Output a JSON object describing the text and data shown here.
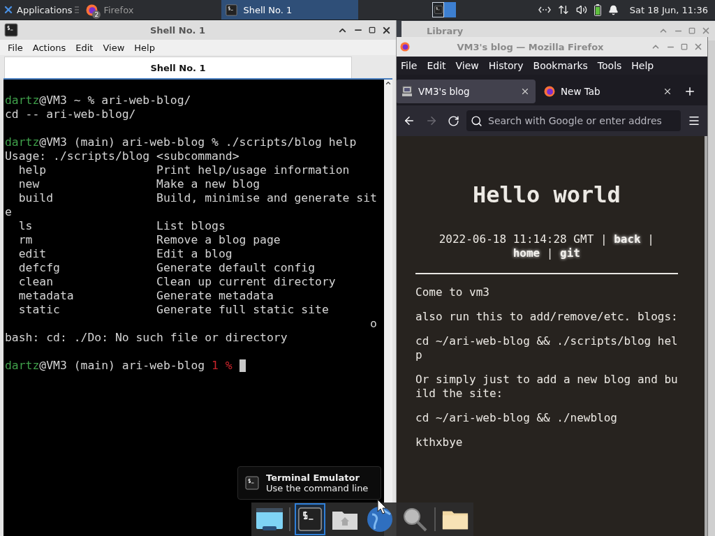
{
  "top_panel": {
    "apps_menu": "Applications",
    "tasks": [
      {
        "label": "Firefox",
        "badge": "2",
        "kind": "browser",
        "selected": false
      },
      {
        "label": "Shell No. 1",
        "kind": "terminal",
        "selected": true
      }
    ],
    "workspaces": [
      {
        "selected": true
      },
      {
        "selected": false
      }
    ],
    "clock": "Sat 18 Jun, 11:36"
  },
  "terminal": {
    "title": "Shell No. 1",
    "menu": [
      "File",
      "Actions",
      "Edit",
      "View",
      "Help"
    ],
    "tabs": [
      {
        "label": "Shell No. 1",
        "selected": true
      }
    ],
    "blocks": [
      {
        "lines": [
          {
            "spans": [
              {
                "text": "dartz",
                "color": "#3f9f4a"
              },
              {
                "text": "@VM3 ~ % ari-web-blog/"
              }
            ]
          },
          {
            "spans": [
              {
                "text": "cd -- ari-web-blog/"
              }
            ]
          }
        ]
      },
      {
        "lines": [
          {
            "spans": [
              {
                "text": "dartz",
                "color": "#3f9f4a"
              },
              {
                "text": "@VM3 (main) ari-web-blog % ./scripts/blog help"
              }
            ]
          },
          {
            "spans": [
              {
                "text": "Usage: ./scripts/blog <subcommand>"
              }
            ]
          },
          {
            "spans": [
              {
                "text": "  help                Print help/usage information"
              }
            ]
          },
          {
            "spans": [
              {
                "text": "  new                 Make a new blog"
              }
            ]
          },
          {
            "spans": [
              {
                "text": "  build               Build, minimise and generate sit"
              }
            ]
          },
          {
            "spans": [
              {
                "text": "e"
              }
            ]
          },
          {
            "spans": [
              {
                "text": "  ls                  List blogs"
              }
            ]
          },
          {
            "spans": [
              {
                "text": "  rm                  Remove a blog page"
              }
            ]
          },
          {
            "spans": [
              {
                "text": "  edit                Edit a blog"
              }
            ]
          },
          {
            "spans": [
              {
                "text": "  defcfg              Generate default config"
              }
            ]
          },
          {
            "spans": [
              {
                "text": "  clean               Clean up current directory"
              }
            ]
          },
          {
            "spans": [
              {
                "text": "  metadata            Generate metadata"
              }
            ]
          },
          {
            "spans": [
              {
                "text": "  static              Generate full static site"
              }
            ]
          },
          {
            "spans": [
              {
                "text": "                                                     o"
              }
            ]
          },
          {
            "spans": [
              {
                "text": "bash: cd: ./Do: No such file or directory"
              }
            ]
          }
        ]
      },
      {
        "lines": [
          {
            "cursor": true,
            "spans": [
              {
                "text": "dartz",
                "color": "#3f9f4a"
              },
              {
                "text": "@VM3 (main) ari-web-blog "
              },
              {
                "text": "1 %",
                "color": "#c8242b"
              }
            ]
          }
        ]
      }
    ]
  },
  "library": {
    "title": "Library"
  },
  "firefox": {
    "title": "VM3's blog — Mozilla Firefox",
    "menu": [
      "File",
      "Edit",
      "View",
      "History",
      "Bookmarks",
      "Tools",
      "Help"
    ],
    "tabs": [
      {
        "label": "VM3's blog",
        "kind": "site",
        "selected": true
      },
      {
        "label": "New Tab",
        "kind": "firefox",
        "selected": false
      }
    ],
    "forward_disabled": true,
    "address": {
      "placeholder": "Search with Google or enter addres"
    },
    "page": {
      "heading": "Hello world",
      "meta": {
        "date": "2022-06-18 11:14:28 GMT",
        "separator": "|",
        "links": [
          "back",
          "home",
          "git"
        ]
      },
      "paragraphs": [
        "Come to vm3",
        "also run this to add/remove/etc. blogs:",
        "cd ~/ari-web-blog && ./scripts/blog help",
        "Or simply just to add a new blog and build the site:",
        "cd ~/ari-web-blog && ./newblog",
        "kthxbye"
      ]
    }
  },
  "tooltip": {
    "title": "Terminal Emulator",
    "subtitle": "Use the command line"
  },
  "dock": [
    {
      "kind": "desktop",
      "selected": false
    },
    {
      "kind": "separator"
    },
    {
      "kind": "terminal",
      "selected": true
    },
    {
      "kind": "home",
      "selected": false
    },
    {
      "kind": "browser",
      "selected": false
    },
    {
      "kind": "search",
      "selected": false
    },
    {
      "kind": "separator"
    },
    {
      "kind": "folder",
      "selected": false
    }
  ]
}
